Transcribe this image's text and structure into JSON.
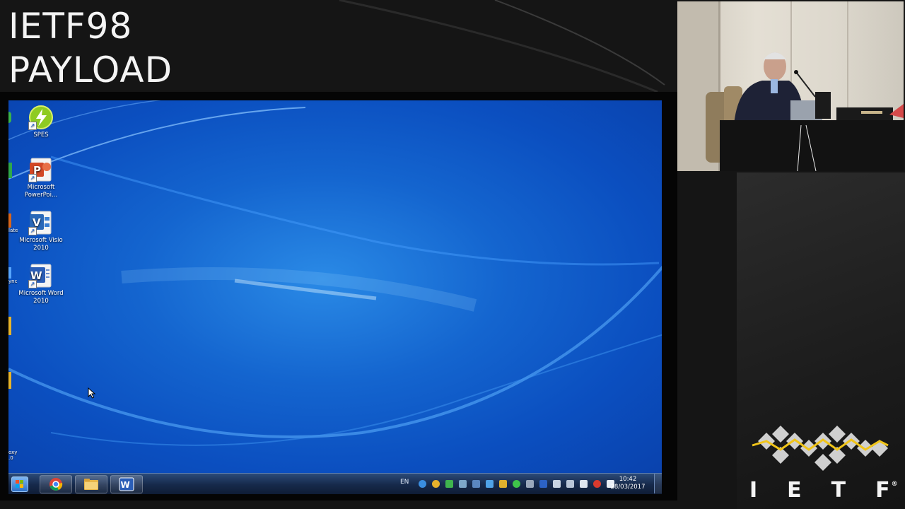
{
  "slide": {
    "title_line1": "IETF98",
    "title_line2": "PAYLOAD"
  },
  "desktop": {
    "icons": [
      {
        "label": "SPES",
        "icon": "spes-icon"
      },
      {
        "label": "Microsoft PowerPoi...",
        "icon": "powerpoint-icon"
      },
      {
        "label": "Microsoft Visio 2010",
        "icon": "visio-icon"
      },
      {
        "label": "Microsoft Word 2010",
        "icon": "word-icon"
      }
    ],
    "edge_labels": [
      "late",
      "ync",
      "oxy",
      ".0"
    ]
  },
  "taskbar": {
    "pinned": [
      "chrome-icon",
      "folder-icon",
      "word-icon"
    ],
    "language": "EN",
    "time": "10:42",
    "date": "28/03/2017"
  },
  "logo": {
    "text": "IETF",
    "trademark": "®"
  },
  "colors": {
    "desktop_blue": "#1465cf",
    "logo_gold": "#f0c419",
    "logo_gray": "#cfcfcf"
  }
}
